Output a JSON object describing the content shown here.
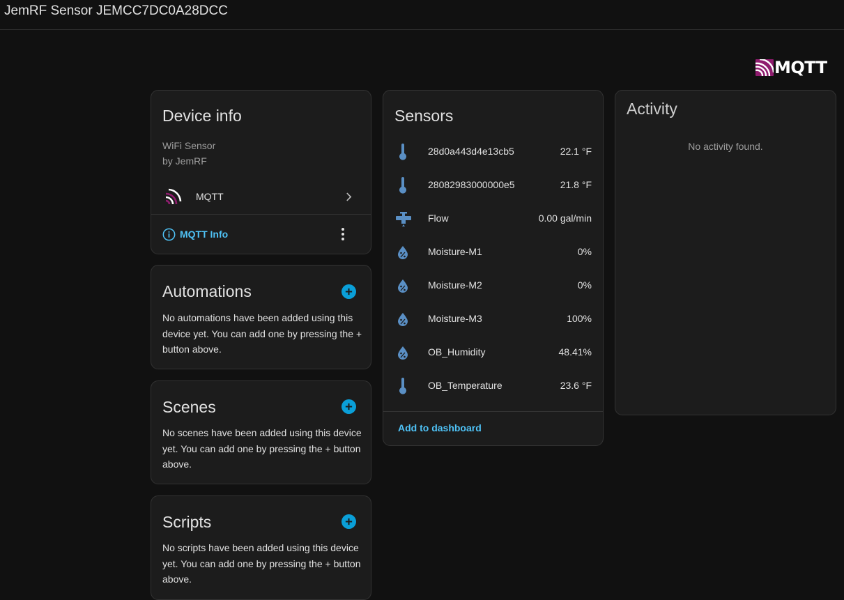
{
  "header": {
    "title": "JemRF Sensor JEMCC7DC0A28DCC"
  },
  "brand": {
    "logo_text": "MQTT",
    "accent": "#8f1c6e"
  },
  "device_info": {
    "title": "Device info",
    "model": "WiFi Sensor",
    "manufacturer": "by JemRF",
    "integration_label": "MQTT",
    "info_link": "MQTT Info"
  },
  "automations": {
    "title": "Automations",
    "empty_text": "No automations have been added using this device yet. You can add one by pressing the + button above."
  },
  "scenes": {
    "title": "Scenes",
    "empty_text": "No scenes have been added using this device yet. You can add one by pressing the + button above."
  },
  "scripts": {
    "title": "Scripts",
    "empty_text": "No scripts have been added using this device yet. You can add one by pressing the + button above."
  },
  "sensors": {
    "title": "Sensors",
    "items": [
      {
        "icon": "thermometer-icon",
        "name": "28d0a443d4e13cb5",
        "value": "22.1 °F"
      },
      {
        "icon": "thermometer-icon",
        "name": "28082983000000e5",
        "value": "21.8 °F"
      },
      {
        "icon": "valve-icon",
        "name": "Flow",
        "value": "0.00 gal/min"
      },
      {
        "icon": "water-percent-icon",
        "name": "Moisture-M1",
        "value": "0%"
      },
      {
        "icon": "water-percent-icon",
        "name": "Moisture-M2",
        "value": "0%"
      },
      {
        "icon": "water-percent-icon",
        "name": "Moisture-M3",
        "value": "100%"
      },
      {
        "icon": "water-percent-icon",
        "name": "OB_Humidity",
        "value": "48.41%"
      },
      {
        "icon": "thermometer-icon",
        "name": "OB_Temperature",
        "value": "23.6 °F"
      }
    ],
    "add_link": "Add to dashboard"
  },
  "activity": {
    "title": "Activity",
    "empty_text": "No activity found."
  }
}
